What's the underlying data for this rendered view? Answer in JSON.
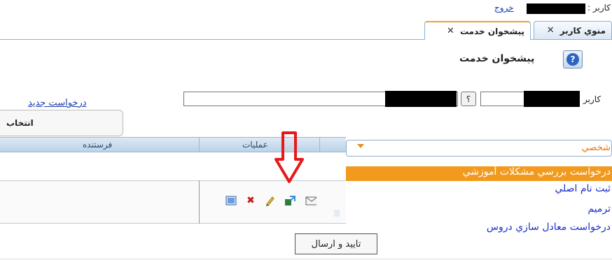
{
  "header": {
    "user_label": "کاربر :",
    "logout_label": "خروج"
  },
  "tabs": [
    {
      "label": "منوي کاربر",
      "close": "✕",
      "active": false
    },
    {
      "label": "پيشخوان خدمت",
      "close": "✕",
      "active": true
    }
  ],
  "page": {
    "title": "پيشخوان خدمت",
    "help_icon": "question-icon"
  },
  "filter": {
    "user_label": "کاربر",
    "lookup_button": "؟",
    "new_request_link": "درخواست جديد",
    "select_button": "انتخاب"
  },
  "grid": {
    "columns": [
      "فرستنده",
      "عمليات"
    ]
  },
  "actions": [
    {
      "icon": "view-icon"
    },
    {
      "icon": "delete-icon"
    },
    {
      "icon": "edit-icon"
    },
    {
      "icon": "approve-send-icon"
    },
    {
      "icon": "envelope-icon"
    }
  ],
  "dropdown": {
    "selected_label": "شخصي"
  },
  "service_list": [
    {
      "label": "درخواست بررسي مشکلات آموزشي",
      "selected": true
    },
    {
      "label": "ثبت نام اصلي",
      "selected": false
    },
    {
      "label": "ترميم",
      "selected": false
    },
    {
      "label": "درخواست معادل سازي دروس",
      "selected": false
    }
  ],
  "tooltip": {
    "text": "تاييد و ارسال"
  },
  "colors": {
    "accent_orange": "#f29a1e",
    "link_blue": "#1a3ea8",
    "header_blue": "#bcd2e8"
  }
}
